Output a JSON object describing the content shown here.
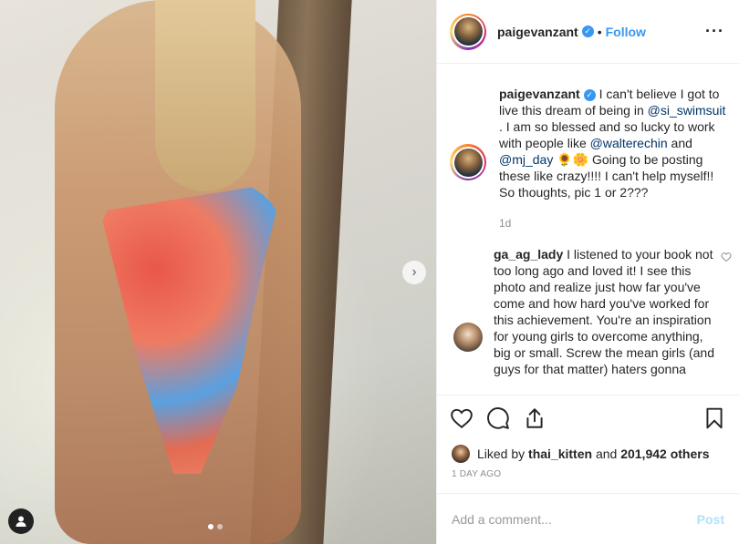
{
  "header": {
    "username": "paigevanzant",
    "bullet": "•",
    "follow_label": "Follow",
    "more_label": "···"
  },
  "caption": {
    "username": "paigevanzant",
    "part1": "I can't believe I got to live this dream of being in",
    "mention1": "@si_swimsuit",
    "part2": ". I am so blessed and so lucky to work with people like",
    "mention2": "@walterechin",
    "part3": "and",
    "mention3": "@mj_day",
    "emoji": "🌻🌼",
    "part4": "Going to be posting these like crazy!!!! I can't help myself!! So thoughts, pic 1 or 2???",
    "time": "1d"
  },
  "comment": {
    "username": "ga_ag_lady",
    "text": "I listened to your book not too long ago and loved it! I see this photo and realize just how far you've come and how hard you've worked for this achievement. You're an inspiration for young girls to overcome anything, big or small. Screw the mean girls (and guys for that matter) haters gonna"
  },
  "likes": {
    "prefix": "Liked by",
    "user": "thai_kitten",
    "and": "and",
    "count": "201,942 others"
  },
  "date": "1 DAY AGO",
  "add_comment": {
    "placeholder": "Add a comment...",
    "post_label": "Post"
  },
  "media": {
    "next_arrow": "›",
    "carousel_total": 2,
    "carousel_active": 1
  },
  "colors": {
    "accent": "#3897f0",
    "mention": "#003569",
    "post_disabled": "#b2dffc"
  },
  "icons": [
    "heart-icon",
    "comment-icon",
    "share-icon",
    "bookmark-icon",
    "user-tag-icon",
    "chevron-right-icon",
    "verified-icon",
    "more-icon"
  ]
}
